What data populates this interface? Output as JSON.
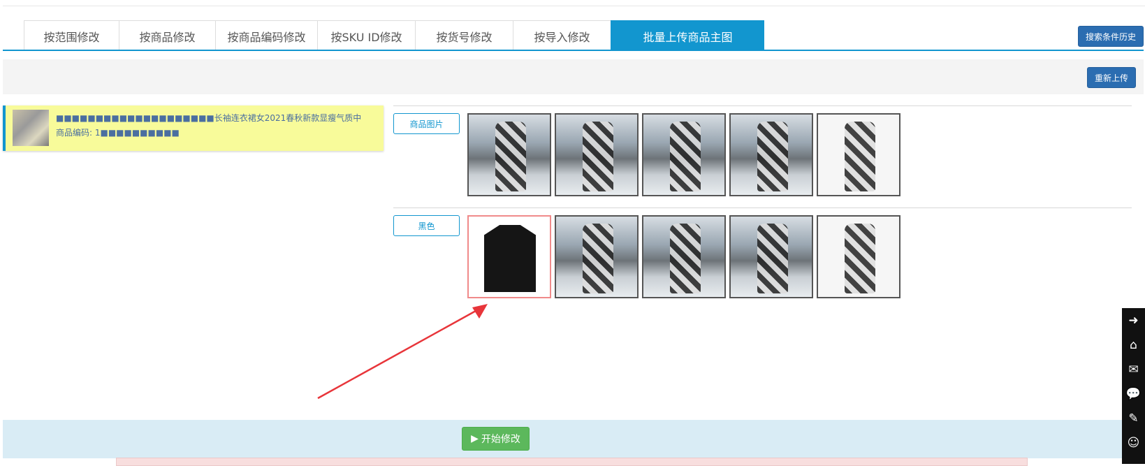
{
  "tabs": [
    {
      "label": "按范围修改",
      "active": false
    },
    {
      "label": "按商品修改",
      "active": false
    },
    {
      "label": "按商品编码修改",
      "active": false
    },
    {
      "label": "按SKU ID修改",
      "active": false
    },
    {
      "label": "按货号修改",
      "active": false
    },
    {
      "label": "按导入修改",
      "active": false
    },
    {
      "label": "批量上传商品主图",
      "active": true
    }
  ],
  "header": {
    "search_history_label": "搜索条件历史"
  },
  "toolbar": {
    "reupload_label": "重新上传"
  },
  "product": {
    "title": "■■■■■■■■■■■■■■■■■■■■长袖连衣裙女2021春秋新款显瘦气质中",
    "code_label": "商品编码: 1■■■■■■■■■■"
  },
  "rows": [
    {
      "label": "商品图片"
    },
    {
      "label": "黑色"
    }
  ],
  "footer": {
    "start_label": "开始修改"
  },
  "dock": {
    "icons": [
      "arrow-right-icon",
      "home-icon",
      "mail-icon",
      "chat-icon",
      "edit-icon",
      "wechat-icon"
    ]
  },
  "colors": {
    "accent": "#1296cf",
    "primary_button": "#2b6db1",
    "success": "#5cb85c",
    "highlight": "#f8fb9a"
  }
}
